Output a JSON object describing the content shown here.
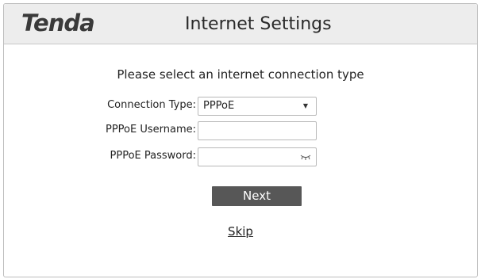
{
  "header": {
    "logo": "Tenda",
    "title": "Internet Settings"
  },
  "main": {
    "prompt": "Please select an internet connection type",
    "connection_type": {
      "label": "Connection Type:",
      "value": "PPPoE"
    },
    "username": {
      "label": "PPPoE Username:",
      "value": ""
    },
    "password": {
      "label": "PPPoE Password:",
      "value": "",
      "toggle_icon": "eye-closed-icon"
    },
    "next_label": "Next",
    "skip_label": "Skip"
  }
}
